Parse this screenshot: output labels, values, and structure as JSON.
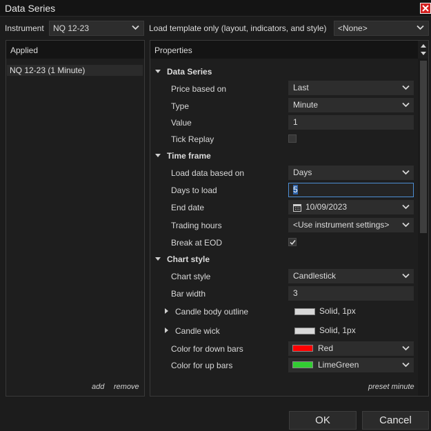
{
  "window": {
    "title": "Data Series"
  },
  "top": {
    "instrument_label": "Instrument",
    "instrument_value": "NQ 12-23",
    "template_label": "Load template only (layout, indicators, and style)",
    "template_value": "<None>"
  },
  "applied": {
    "header": "Applied",
    "items": [
      "NQ 12-23 (1 Minute)"
    ],
    "add_label": "add",
    "remove_label": "remove"
  },
  "properties": {
    "header": "Properties",
    "categories": {
      "data_series": "Data Series",
      "time_frame": "Time frame",
      "chart_style": "Chart style"
    },
    "rows": {
      "price_based_on": {
        "label": "Price based on",
        "value": "Last"
      },
      "type": {
        "label": "Type",
        "value": "Minute"
      },
      "value": {
        "label": "Value",
        "value": "1"
      },
      "tick_replay": {
        "label": "Tick Replay",
        "checked": false
      },
      "load_data_based_on": {
        "label": "Load data based on",
        "value": "Days"
      },
      "days_to_load": {
        "label": "Days to load",
        "value": "5"
      },
      "end_date": {
        "label": "End date",
        "value": "10/09/2023"
      },
      "trading_hours": {
        "label": "Trading hours",
        "value": "<Use instrument settings>"
      },
      "break_at_eod": {
        "label": "Break at EOD",
        "checked": true
      },
      "chart_style": {
        "label": "Chart style",
        "value": "Candlestick"
      },
      "bar_width": {
        "label": "Bar width",
        "value": "3"
      },
      "candle_body_outline": {
        "label": "Candle body outline",
        "value": "Solid, 1px",
        "color": "#d8d8d8"
      },
      "candle_wick": {
        "label": "Candle wick",
        "value": "Solid, 1px",
        "color": "#d8d8d8"
      },
      "color_down_bars": {
        "label": "Color for down bars",
        "value": "Red",
        "color": "#ff0000"
      },
      "color_up_bars": {
        "label": "Color for up bars",
        "value": "LimeGreen",
        "color": "#32cd32"
      }
    },
    "preset_label": "preset minute"
  },
  "buttons": {
    "ok": "OK",
    "cancel": "Cancel"
  },
  "icons": [
    "close-icon",
    "chevron-down-icon",
    "calendar-icon",
    "scroll-up-icon",
    "scroll-down-icon"
  ]
}
